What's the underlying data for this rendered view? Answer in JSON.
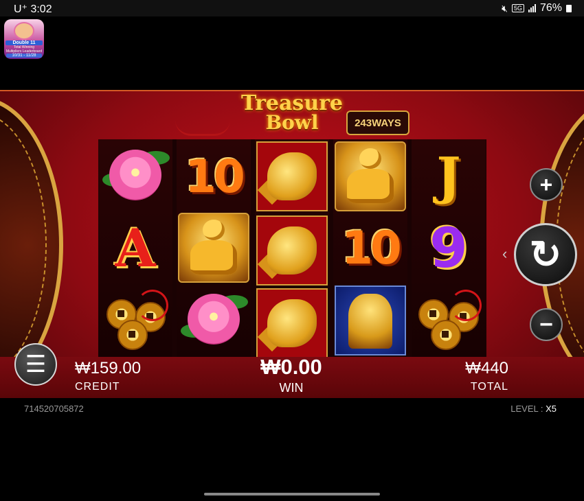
{
  "status_bar": {
    "carrier": "U⁺ 3:02",
    "battery": "76%",
    "network": "5G"
  },
  "promo": {
    "line1": "Double 11",
    "line2": "Total Winning",
    "line3": "Multipliers Leaderboard",
    "dates": "10/31 - 11/28"
  },
  "game": {
    "title_line1": "Treasure",
    "title_line2": "Bowl",
    "ways": "243WAYS"
  },
  "reels": [
    [
      "peony",
      "A",
      "coins"
    ],
    [
      "10",
      "buddha",
      "peony"
    ],
    [
      "golden-fish",
      "golden-fish",
      "golden-fish"
    ],
    [
      "buddha",
      "10",
      "foo-dog"
    ],
    [
      "J",
      "9",
      "coins"
    ]
  ],
  "symbol_text": {
    "ten": "10",
    "ace": "A",
    "nine": "9",
    "jack": "J"
  },
  "info": {
    "credit_value": "₩159.00",
    "credit_label": "CREDIT",
    "win_value": "₩0.00",
    "win_label": "WIN",
    "total_value": "₩440",
    "total_label": "TOTAL"
  },
  "round_id": "714520705872",
  "level": {
    "label": "LEVEL : ",
    "value": "X5"
  },
  "buttons": {
    "plus": "+",
    "minus": "−",
    "spin": "↻",
    "menu": "☰",
    "spin_arrow": "‹"
  }
}
